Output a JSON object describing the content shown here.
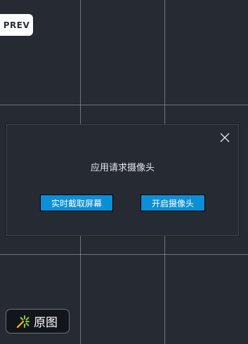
{
  "prev_button": {
    "label": "PREV"
  },
  "dialog": {
    "title": "应用请求摄像头",
    "buttons": {
      "screen_capture": "实时截取屏幕",
      "open_camera": "开启摄像头"
    },
    "close_icon": "close-icon"
  },
  "original_button": {
    "label": "原图",
    "icon": "sparkle-wand-icon"
  },
  "colors": {
    "background": "#252a33",
    "button_blue": "#0b8fd6",
    "spark_green": "#8bc34a",
    "spark_yellow": "#ffc107"
  }
}
